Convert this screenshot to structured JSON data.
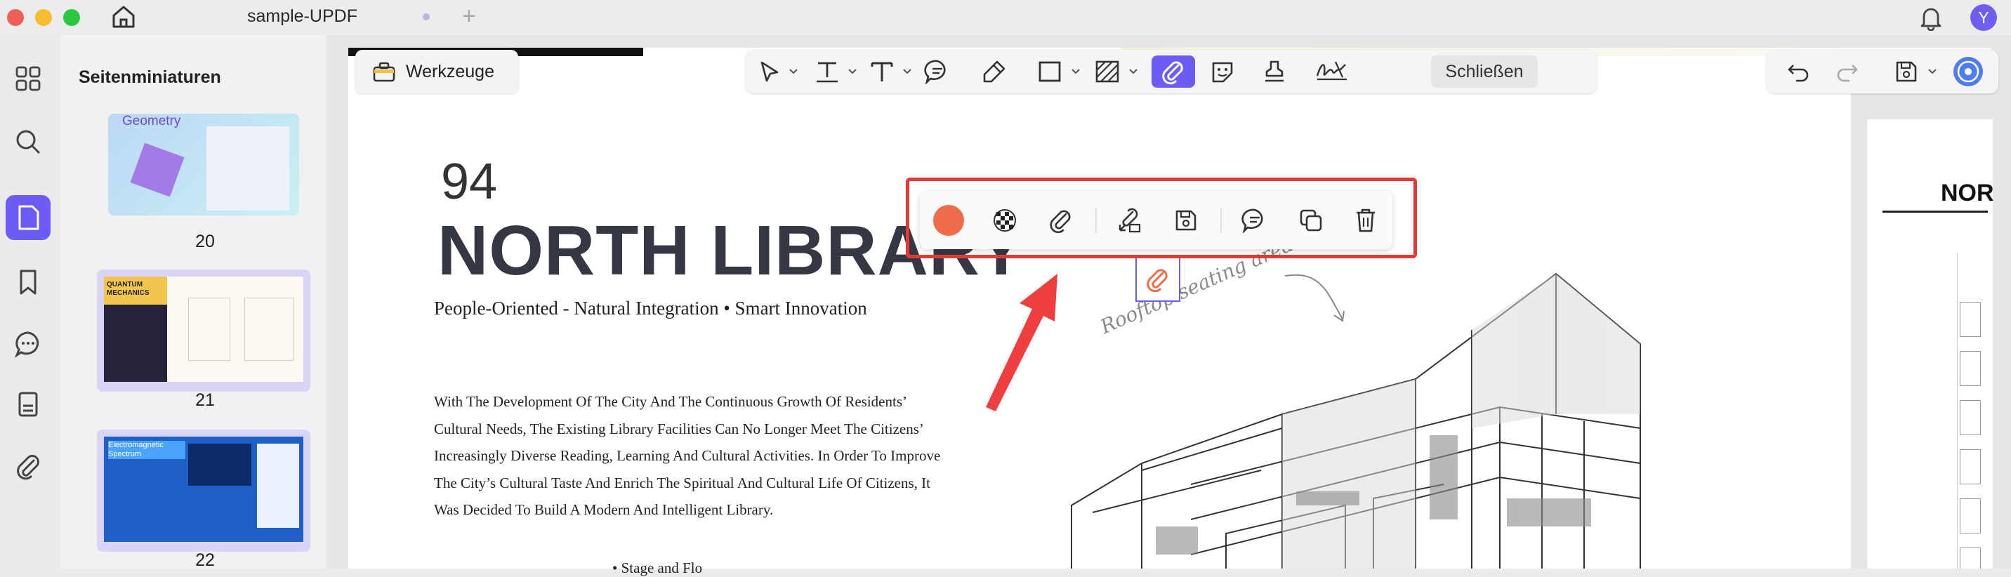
{
  "window": {
    "doc_title": "sample-UPDF",
    "user_initial": "Y"
  },
  "sidebar": {
    "panel_title": "Seitenminiaturen",
    "thumbnails": [
      {
        "page": "20",
        "title": "Geometry"
      },
      {
        "page": "21",
        "title": "QUANTUM MECHANICS"
      },
      {
        "page": "22",
        "title": "Electromagnetic Spectrum"
      }
    ]
  },
  "toolbar": {
    "tools_label": "Werkzeuge",
    "close_label": "Schließen"
  },
  "document": {
    "page_number": "94",
    "title": "NORTH LIBRARY",
    "subtitle": "People-Oriented - Natural Integration • Smart Innovation",
    "body_lines": [
      "With The Development Of The City And The Continuous Growth Of Residents’",
      "Cultural Needs, The Existing Library Facilities Can No Longer Meet The Citizens’",
      "Increasingly Diverse Reading, Learning And Cultural Activities. In Order To Improve",
      "The City’s Cultural Taste And Enrich The Spiritual And Cultural Life Of Citizens, It",
      "Was Decided To Build A Modern And Intelligent Library."
    ],
    "bullet_text": "Stage and Flo",
    "handwritten_note": "Rooftop seating area",
    "right_page_title": "NOR"
  },
  "colors": {
    "accent": "#6b5cf6",
    "highlight_frame": "#e53935",
    "annotation_color": "#ef6c4a"
  }
}
